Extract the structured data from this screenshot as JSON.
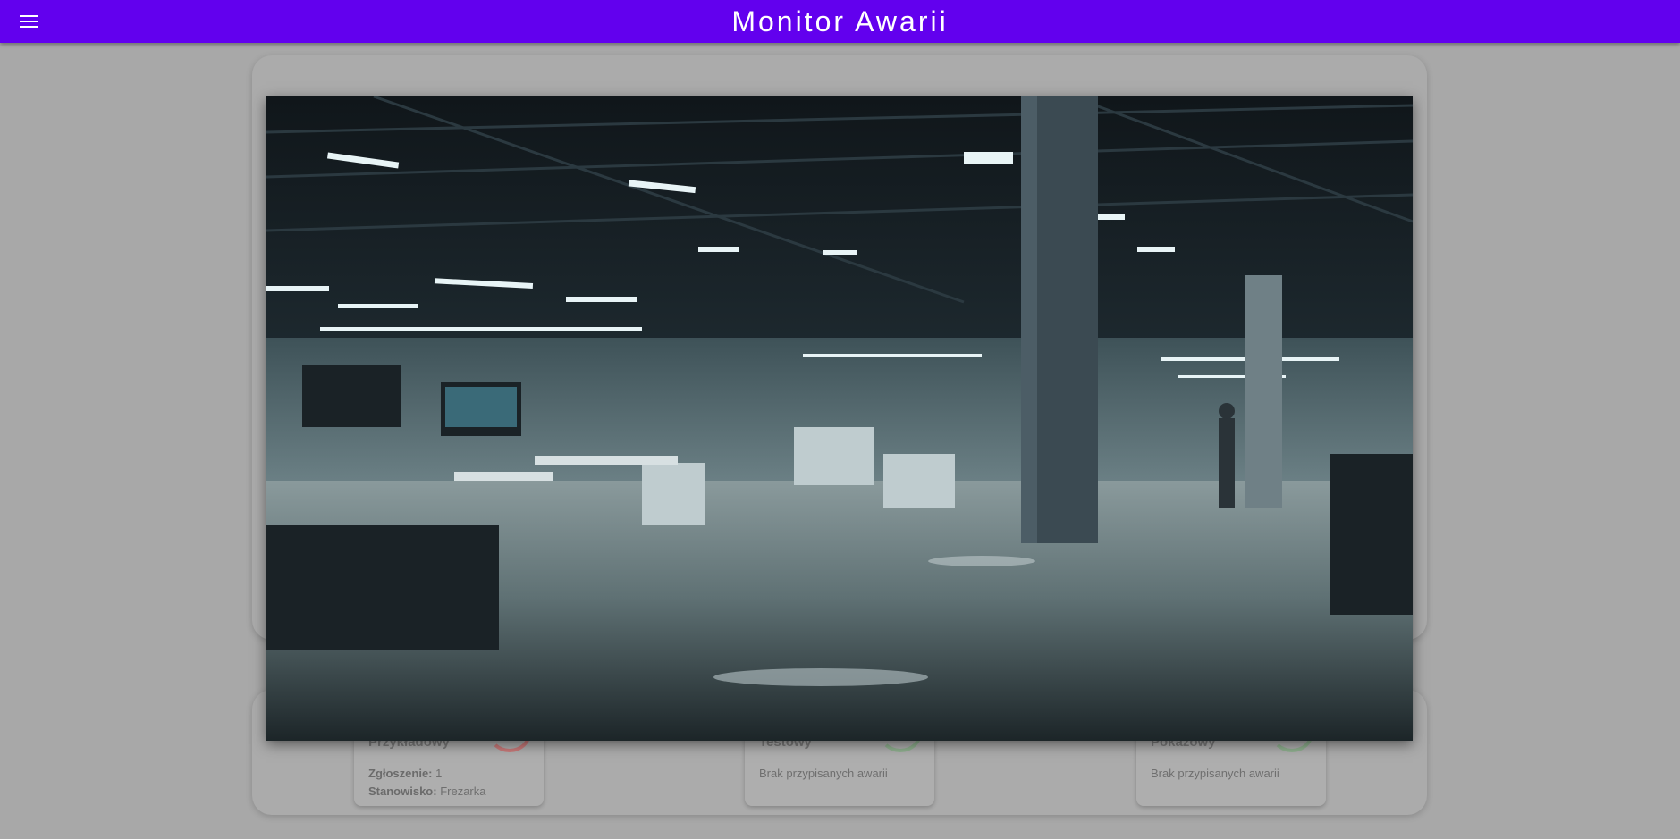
{
  "app_bar": {
    "title": "Monitor Awarii",
    "menu_icon": "menu-icon",
    "background": "#6200ee"
  },
  "stations": [
    {
      "name": "Przykładowy",
      "status_color": "#c97a7a",
      "report_label": "Zgłoszenie:",
      "report_value": "1",
      "station_label": "Stanowisko:",
      "station_value": "Frezarka"
    },
    {
      "name": "Testowy",
      "status_color": "#8fb08f",
      "message": "Brak przypisanych awarii"
    },
    {
      "name": "Pokazowy",
      "status_color": "#8fb08f",
      "message": "Brak przypisanych awarii"
    }
  ],
  "overlay": {
    "image_subject": "factory-floor-photo"
  }
}
